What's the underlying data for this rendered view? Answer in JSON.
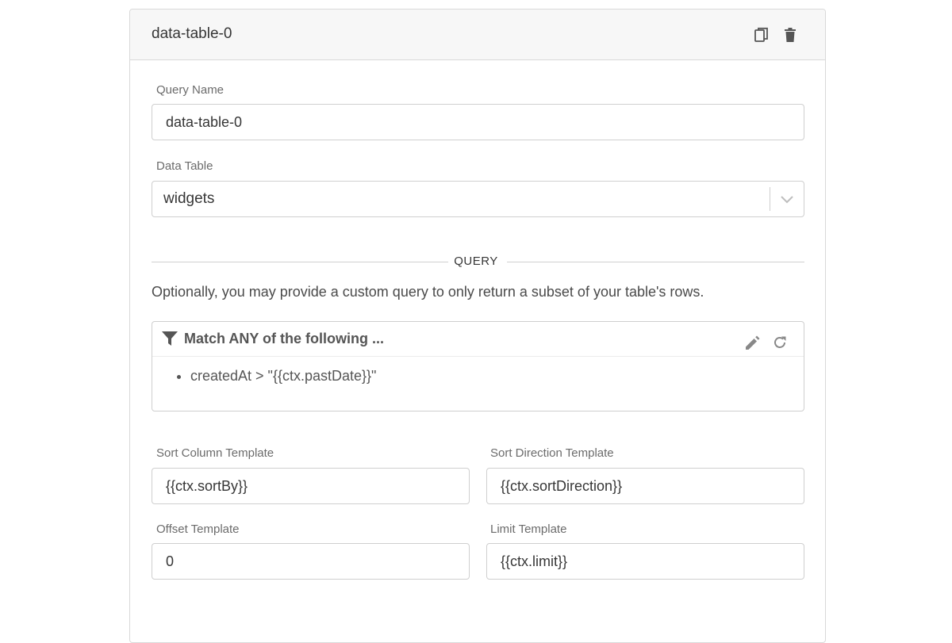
{
  "header": {
    "title": "data-table-0",
    "copy_icon": "copy-icon",
    "delete_icon": "trash-icon"
  },
  "query_name": {
    "label": "Query Name",
    "value": "data-table-0"
  },
  "data_table": {
    "label": "Data Table",
    "value": "widgets"
  },
  "query_section": {
    "title": "QUERY",
    "description": "Optionally, you may provide a custom query to only return a subset of your table's rows.",
    "filter": {
      "title": "Match ANY of the following ...",
      "conditions": [
        "createdAt > \"{{ctx.pastDate}}\""
      ]
    }
  },
  "templates": {
    "sort_column": {
      "label": "Sort Column Template",
      "value": "{{ctx.sortBy}}"
    },
    "sort_direction": {
      "label": "Sort Direction Template",
      "value": "{{ctx.sortDirection}}"
    },
    "offset": {
      "label": "Offset Template",
      "value": "0"
    },
    "limit": {
      "label": "Limit Template",
      "value": "{{ctx.limit}}"
    }
  },
  "colors": {
    "border": "#cfcfcf",
    "header_bg": "#f7f7f7",
    "text": "#363636",
    "muted": "#6b6b6b"
  }
}
